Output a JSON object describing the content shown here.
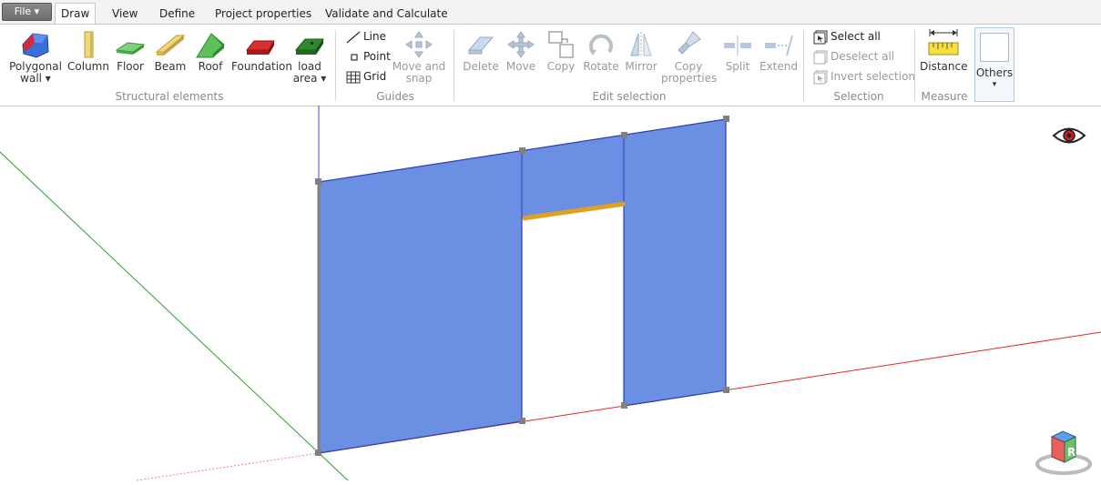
{
  "file_menu": {
    "label": "File ▾"
  },
  "tabs": [
    {
      "label": "Draw",
      "active": true
    },
    {
      "label": "View"
    },
    {
      "label": "Define"
    },
    {
      "label": "Project properties"
    },
    {
      "label": "Validate and Calculate"
    }
  ],
  "structural": {
    "group_label": "Structural elements",
    "polygonal_wall": {
      "label_line1": "Polygonal",
      "label_line2": "wall ▾"
    },
    "column": {
      "label": "Column"
    },
    "floor": {
      "label": "Floor"
    },
    "beam": {
      "label": "Beam"
    },
    "roof": {
      "label": "Roof"
    },
    "foundation": {
      "label": "Foundation"
    },
    "load_area": {
      "label_line1": "load",
      "label_line2": "area ▾"
    }
  },
  "guides": {
    "group_label": "Guides",
    "line": {
      "label": "Line"
    },
    "point": {
      "label": "Point"
    },
    "grid": {
      "label": "Grid"
    },
    "move_and_snap": {
      "label_line1": "Move and",
      "label_line2": "snap"
    }
  },
  "edit_selection": {
    "group_label": "Edit selection",
    "delete": {
      "label": "Delete"
    },
    "move": {
      "label": "Move"
    },
    "copy": {
      "label": "Copy"
    },
    "rotate": {
      "label": "Rotate"
    },
    "mirror": {
      "label": "Mirror"
    },
    "copy_properties": {
      "label_line1": "Copy",
      "label_line2": "properties"
    },
    "split": {
      "label": "Split"
    },
    "extend": {
      "label": "Extend"
    }
  },
  "selection": {
    "group_label": "Selection",
    "select_all": {
      "label": "Select all"
    },
    "deselect_all": {
      "label": "Deselect all"
    },
    "invert_selection": {
      "label": "Invert selection"
    }
  },
  "measure": {
    "group_label": "Measure",
    "distance": {
      "label": "Distance"
    }
  },
  "others": {
    "label": "Others",
    "arrow": "▾"
  },
  "view_cube": {
    "face_label": "R"
  },
  "colors": {
    "wall_fill": "#6b8fe3",
    "wall_edge": "#2f3fb0",
    "beam": "#e0a020",
    "x_axis": "#e02020",
    "y_axis": "#20a020",
    "z_axis": "#4040d0"
  }
}
